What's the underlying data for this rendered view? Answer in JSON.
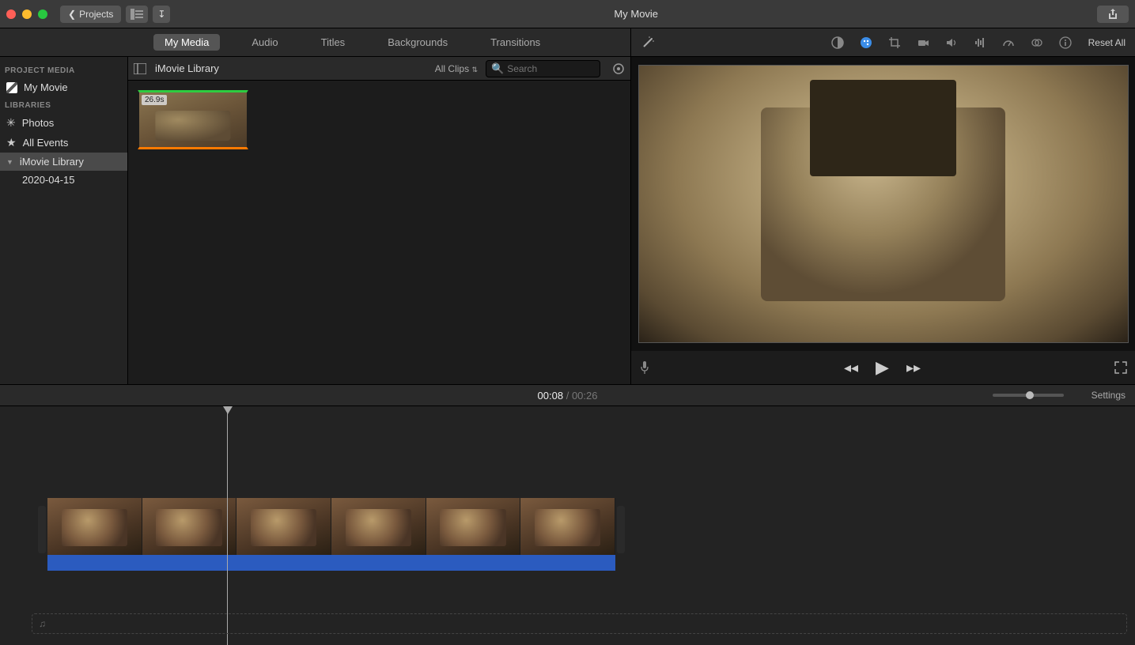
{
  "titlebar": {
    "back_label": "Projects",
    "window_title": "My Movie"
  },
  "tabs": {
    "my_media": "My Media",
    "audio": "Audio",
    "titles": "Titles",
    "backgrounds": "Backgrounds",
    "transitions": "Transitions"
  },
  "sidebar": {
    "project_media_heading": "PROJECT MEDIA",
    "project_item": "My Movie",
    "libraries_heading": "LIBRARIES",
    "photos": "Photos",
    "all_events": "All Events",
    "imovie_library": "iMovie Library",
    "date_event": "2020-04-15"
  },
  "browser": {
    "library_label": "iMovie Library",
    "all_clips": "All Clips",
    "search_placeholder": "Search",
    "clip_duration": "26.9s"
  },
  "preview": {
    "reset_all": "Reset All"
  },
  "time": {
    "current": "00:08",
    "separator": "/",
    "total": "00:26",
    "settings": "Settings"
  },
  "music_track": {
    "placeholder_icon": "♫"
  }
}
